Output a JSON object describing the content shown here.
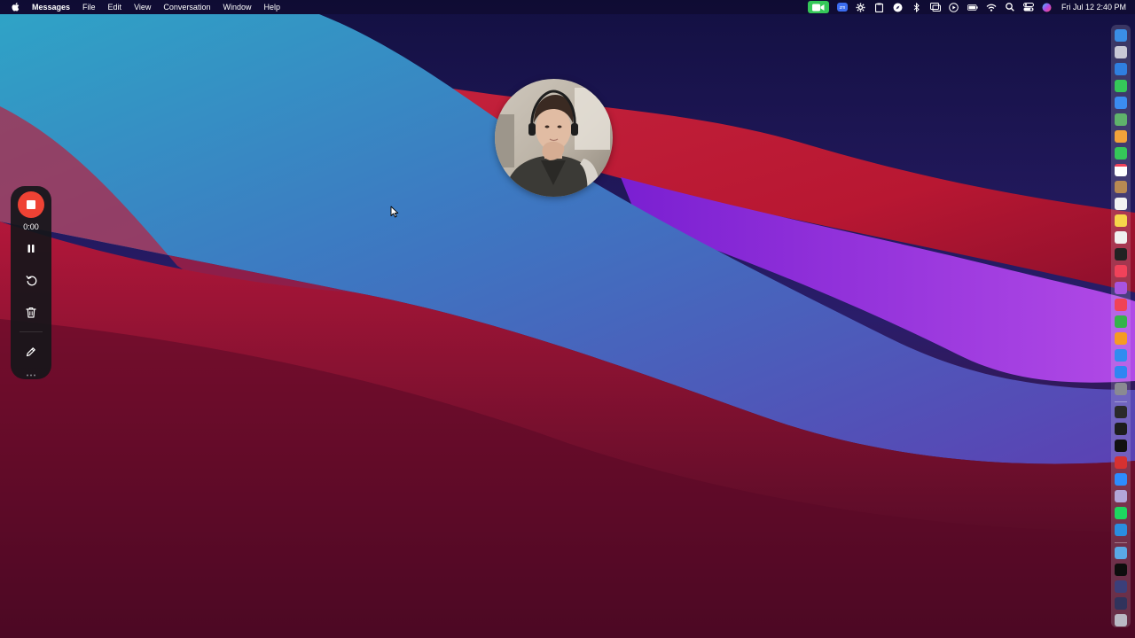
{
  "menubar": {
    "app_name": "Messages",
    "menus": [
      "File",
      "Edit",
      "View",
      "Conversation",
      "Window",
      "Help"
    ],
    "status_icons": [
      "facetime-video-icon",
      "zoom-icon",
      "gear-icon",
      "clipboard-icon",
      "compass-icon",
      "bluetooth-icon",
      "screen-mirroring-icon",
      "play-icon",
      "battery-icon",
      "wifi-icon",
      "search-icon",
      "control-center-icon",
      "siri-icon"
    ],
    "clock": "Fri Jul 12  2:40 PM"
  },
  "recorder": {
    "timer": "0:00",
    "buttons": [
      "stop-icon",
      "pause-icon",
      "restart-icon",
      "trash-icon",
      "pencil-icon"
    ],
    "accent_color": "#ef4234"
  },
  "camera_bubble": {
    "kind": "webcam-preview"
  },
  "dock": {
    "icons": [
      {
        "name": "finder-icon",
        "color": "#3a8ee6"
      },
      {
        "name": "launchpad-icon",
        "color": "#c9c9d6"
      },
      {
        "name": "safari-icon",
        "color": "#2f7fe0"
      },
      {
        "name": "messages-icon",
        "color": "#35c759"
      },
      {
        "name": "mail-icon",
        "color": "#3b8cf0"
      },
      {
        "name": "maps-icon",
        "color": "#5fb36b"
      },
      {
        "name": "photos-icon",
        "color": "#f2a33a"
      },
      {
        "name": "facetime-icon",
        "color": "#35c759"
      },
      {
        "name": "calendar-icon",
        "color": "#f4f4f4"
      },
      {
        "name": "contacts-icon",
        "color": "#b88a52"
      },
      {
        "name": "reminders-icon",
        "color": "#f2f2f2"
      },
      {
        "name": "notes-icon",
        "color": "#f6d64a"
      },
      {
        "name": "freeform-icon",
        "color": "#f0f0f0"
      },
      {
        "name": "apple-tv-icon",
        "color": "#222222"
      },
      {
        "name": "music-icon",
        "color": "#f0425a"
      },
      {
        "name": "podcasts-icon",
        "color": "#a854e0"
      },
      {
        "name": "news-icon",
        "color": "#f04355"
      },
      {
        "name": "numbers-icon",
        "color": "#35b34a"
      },
      {
        "name": "pages-icon",
        "color": "#f59b23"
      },
      {
        "name": "keynote-icon",
        "color": "#2f8cf0"
      },
      {
        "name": "app-store-icon",
        "color": "#2e86f2"
      },
      {
        "name": "system-settings-icon",
        "color": "#8a8a92"
      },
      {
        "name": "chatgpt-icon",
        "color": "#2a2a2a"
      },
      {
        "name": "terminal-icon",
        "color": "#1d1d1d"
      },
      {
        "name": "iterm-icon",
        "color": "#111111"
      },
      {
        "name": "screen-recorder-icon",
        "color": "#d63131"
      },
      {
        "name": "zoom-app-icon",
        "color": "#2d8cff"
      },
      {
        "name": "preview-icon",
        "color": "#b2a6d9"
      },
      {
        "name": "spotify-icon",
        "color": "#1ed760"
      },
      {
        "name": "vscode-icon",
        "color": "#2a8ee0"
      },
      {
        "name": "downloads-folder-icon",
        "color": "#5aa9e6"
      },
      {
        "name": "window-thumbnail-icon",
        "color": "#0d0d0d"
      },
      {
        "name": "window-thumbnail-2-icon",
        "color": "#3b3f7a"
      },
      {
        "name": "window-thumbnail-3-icon",
        "color": "#30335c"
      },
      {
        "name": "trash-bin-icon",
        "color": "#b9b9c4"
      }
    ]
  }
}
